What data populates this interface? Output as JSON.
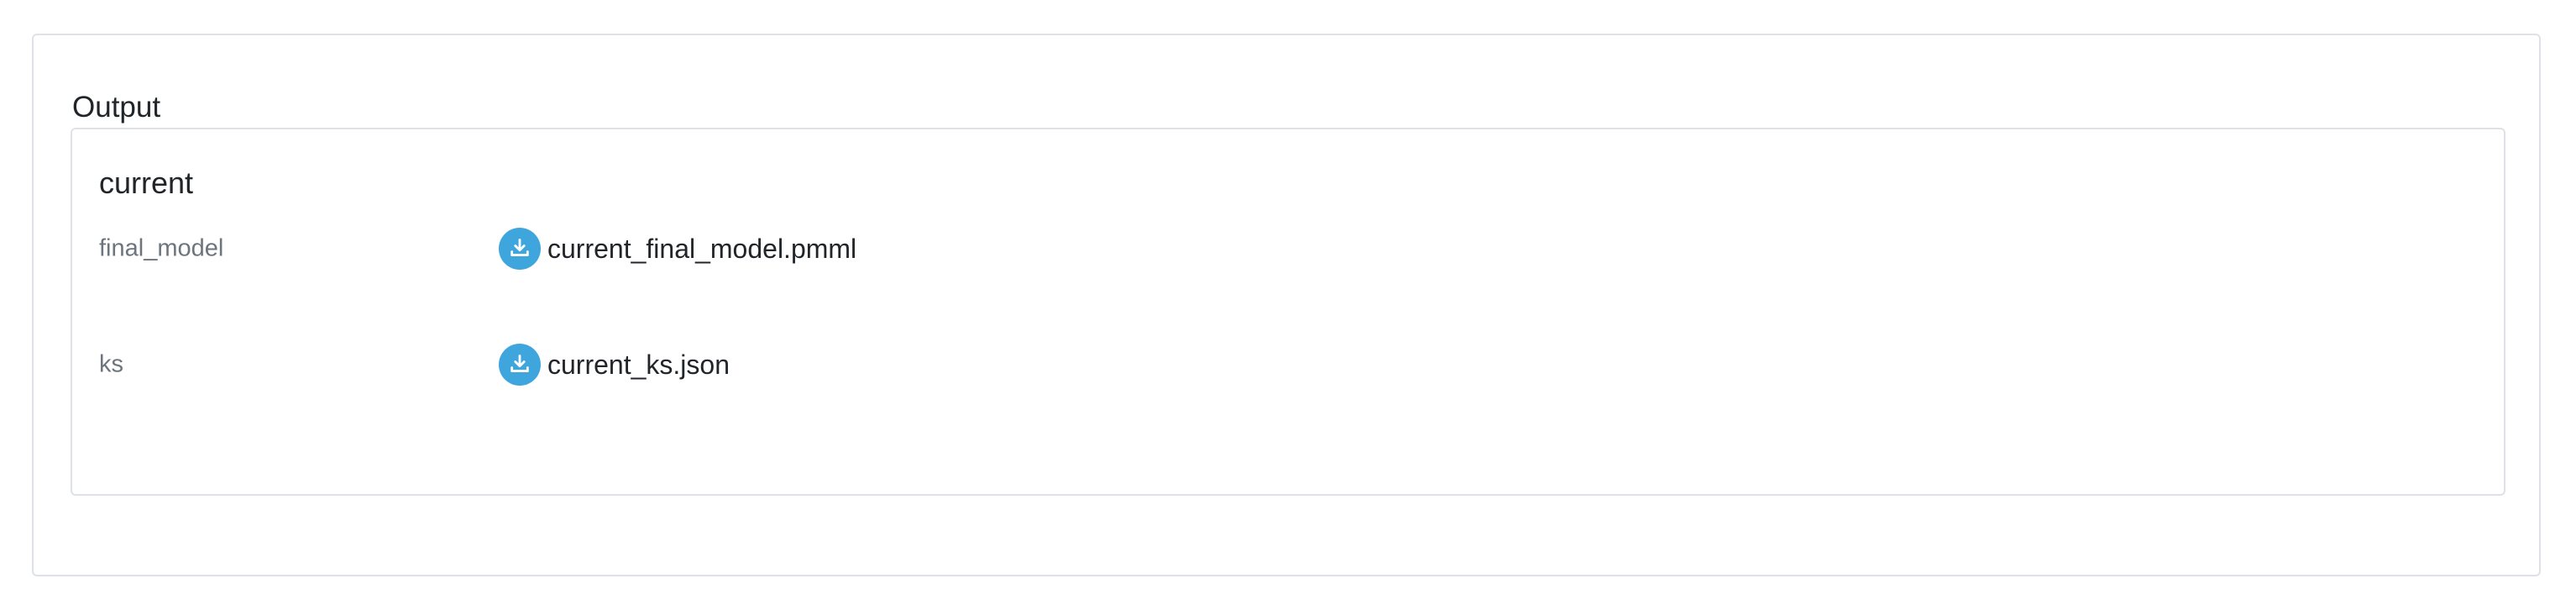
{
  "output": {
    "title": "Output",
    "sections": [
      {
        "title": "current",
        "rows": [
          {
            "label": "final_model",
            "icon": "download-icon",
            "file_name": "current_final_model.pmml"
          },
          {
            "label": "ks",
            "icon": "download-icon",
            "file_name": "current_ks.json"
          }
        ]
      }
    ]
  },
  "colors": {
    "accent": "#3ea6dd",
    "border": "#dee2e6",
    "muted_text": "#6c757d",
    "text": "#212529"
  }
}
